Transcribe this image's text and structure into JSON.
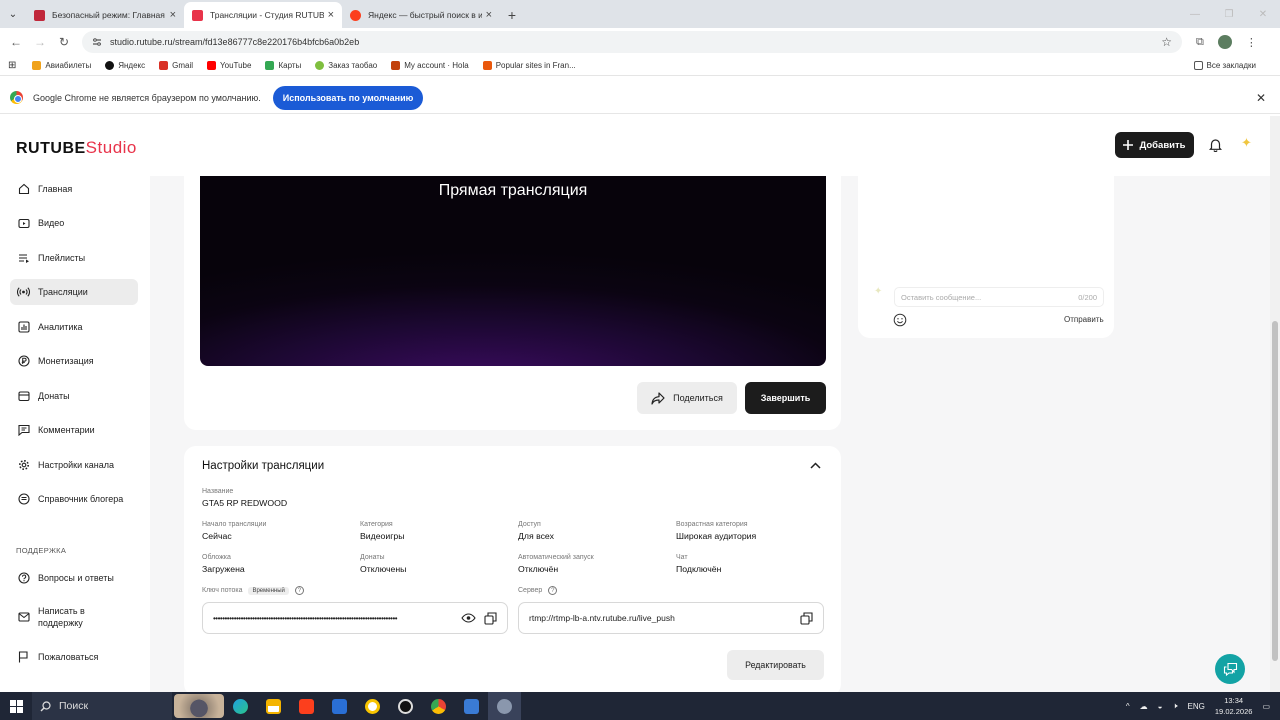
{
  "browser": {
    "tabs": [
      {
        "title": "Безопасный режим: Главная -",
        "favicon_color": "#c0273a",
        "active": false
      },
      {
        "title": "Трансляции - Студия RUTUBE",
        "favicon_color": "#e8334a",
        "active": true
      },
      {
        "title": "Яндекс — быстрый поиск в и",
        "favicon_color": "#fc3f1d",
        "active": false
      }
    ],
    "url": "studio.rutube.ru/stream/fd13e86777c8e220176b4bfcb6a0b2eb",
    "bookmarks": [
      {
        "label": "Авиабилеты",
        "color": "#f0a21b"
      },
      {
        "label": "Яндекс",
        "color": "#111111"
      },
      {
        "label": "Gmail",
        "color": "#d93025"
      },
      {
        "label": "YouTube",
        "color": "#ff0000"
      },
      {
        "label": "Карты",
        "color": "#34a853"
      },
      {
        "label": "Заказ таобао",
        "color": "#7fbf3f"
      },
      {
        "label": "My account · Hola",
        "color": "#c2410c"
      },
      {
        "label": "Popular sites in Fran...",
        "color": "#ea580c"
      }
    ],
    "all_bookmarks_label": "Все закладки",
    "infobar": {
      "message": "Google Chrome не является браузером по умолчанию.",
      "button_label": "Использовать по умолчанию"
    }
  },
  "app": {
    "logo_main": "RUTUBE",
    "logo_studio": "Studio",
    "add_button_label": "Добавить",
    "sidebar": {
      "items": [
        {
          "label": "Главная",
          "icon": "home-icon"
        },
        {
          "label": "Видео",
          "icon": "video-icon"
        },
        {
          "label": "Плейлисты",
          "icon": "playlist-icon"
        },
        {
          "label": "Трансляции",
          "icon": "broadcast-icon",
          "active": true
        },
        {
          "label": "Аналитика",
          "icon": "chart-icon"
        },
        {
          "label": "Монетизация",
          "icon": "money-icon"
        },
        {
          "label": "Донаты",
          "icon": "donate-icon"
        },
        {
          "label": "Комментарии",
          "icon": "comment-icon"
        },
        {
          "label": "Настройки канала",
          "icon": "gear-icon"
        },
        {
          "label": "Справочник блогера",
          "icon": "book-icon"
        }
      ],
      "support_heading": "ПОДДЕРЖКА",
      "support_items": [
        {
          "label": "Вопросы и ответы",
          "icon": "question-icon"
        },
        {
          "label": "Написать в поддержку",
          "icon": "mail-icon"
        },
        {
          "label": "Пожаловаться",
          "icon": "flag-icon"
        }
      ]
    },
    "player": {
      "title": "Прямая трансляция",
      "share_label": "Поделиться",
      "finish_label": "Завершить"
    },
    "chat": {
      "placeholder": "Оставить сообщение...",
      "counter": "0/200",
      "send_label": "Отправить"
    },
    "settings": {
      "title": "Настройки трансляции",
      "name_label": "Название",
      "name_value": "GTA5 RP REDWOOD",
      "fields": [
        {
          "label": "Начало трансляции",
          "value": "Сейчас"
        },
        {
          "label": "Категория",
          "value": "Видеоигры"
        },
        {
          "label": "Доступ",
          "value": "Для всех"
        },
        {
          "label": "Возрастная категория",
          "value": "Широкая аудитория"
        },
        {
          "label": "Обложка",
          "value": "Загружена"
        },
        {
          "label": "Донаты",
          "value": "Отключены"
        },
        {
          "label": "Автоматический запуск",
          "value": "Отключён"
        },
        {
          "label": "Чат",
          "value": "Подключён"
        }
      ],
      "stream_key_label": "Ключ потока",
      "stream_key_tag": "Временный",
      "stream_key_masked": "••••••••••••••••••••••••••••••••••••••••••••••••••••••••••••••••••••••••••••••••",
      "server_label": "Сервер",
      "server_value": "rtmp://rtmp-lb-a.ntv.rutube.ru/live_push",
      "edit_label": "Редактировать"
    }
  },
  "taskbar": {
    "search_label": "Поиск",
    "lang": "ENG",
    "time": "13:34",
    "date": "19.02.2026"
  }
}
